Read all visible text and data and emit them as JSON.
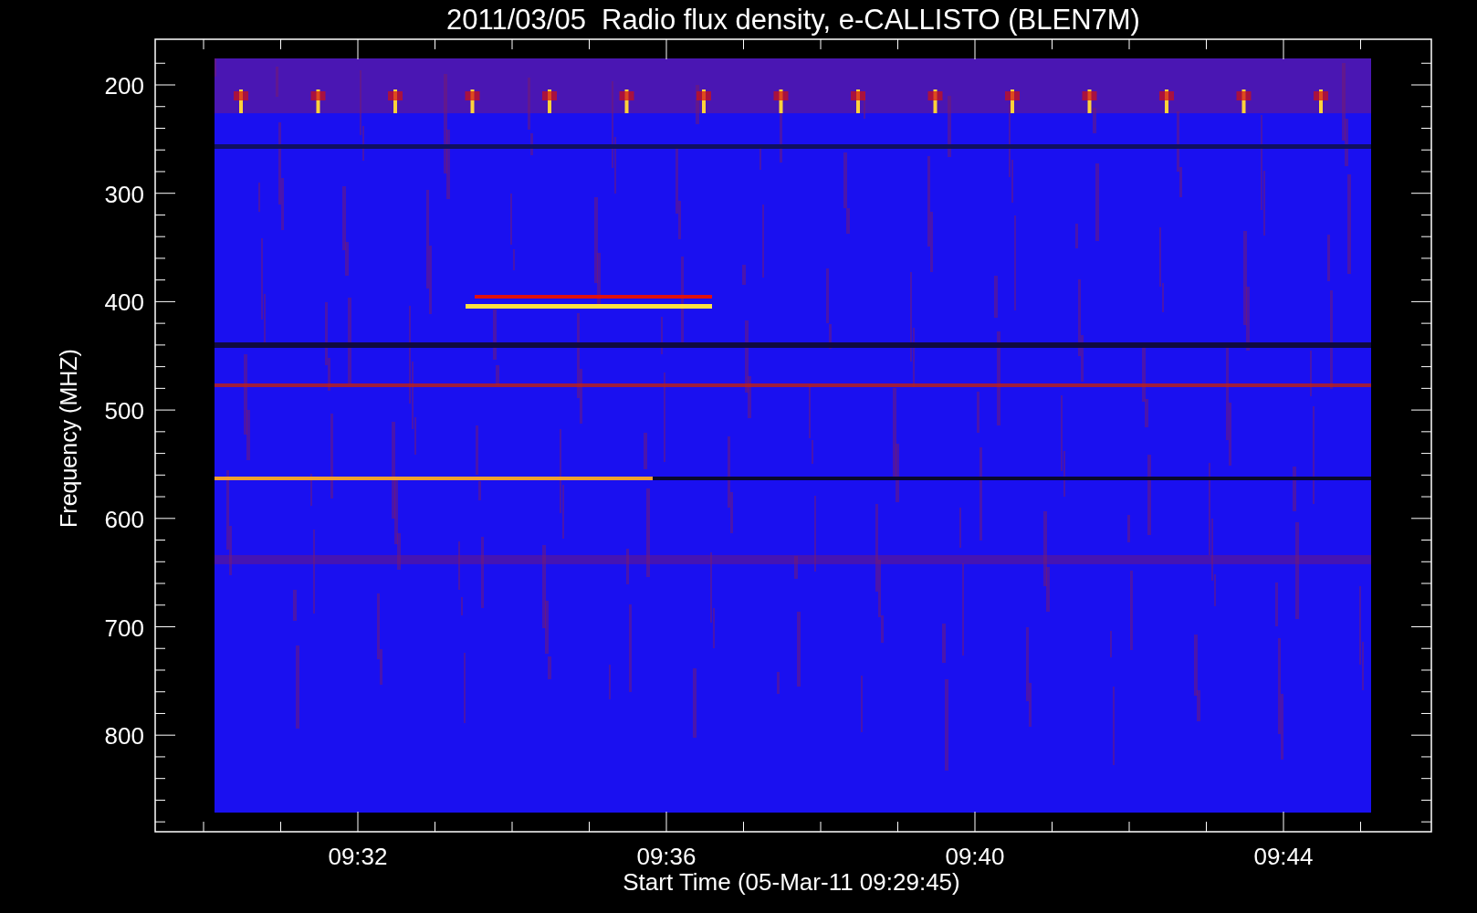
{
  "title": "2011/03/05  Radio flux density, e-CALLISTO (BLEN7M)",
  "y_axis": {
    "label": "Frequency (MHZ)",
    "ticks": [
      "200",
      "300",
      "400",
      "500",
      "600",
      "700",
      "800"
    ]
  },
  "x_axis": {
    "label": "Start Time (05-Mar-11 09:29:45)",
    "ticks": [
      "09:32",
      "09:36",
      "09:40",
      "09:44"
    ]
  }
}
